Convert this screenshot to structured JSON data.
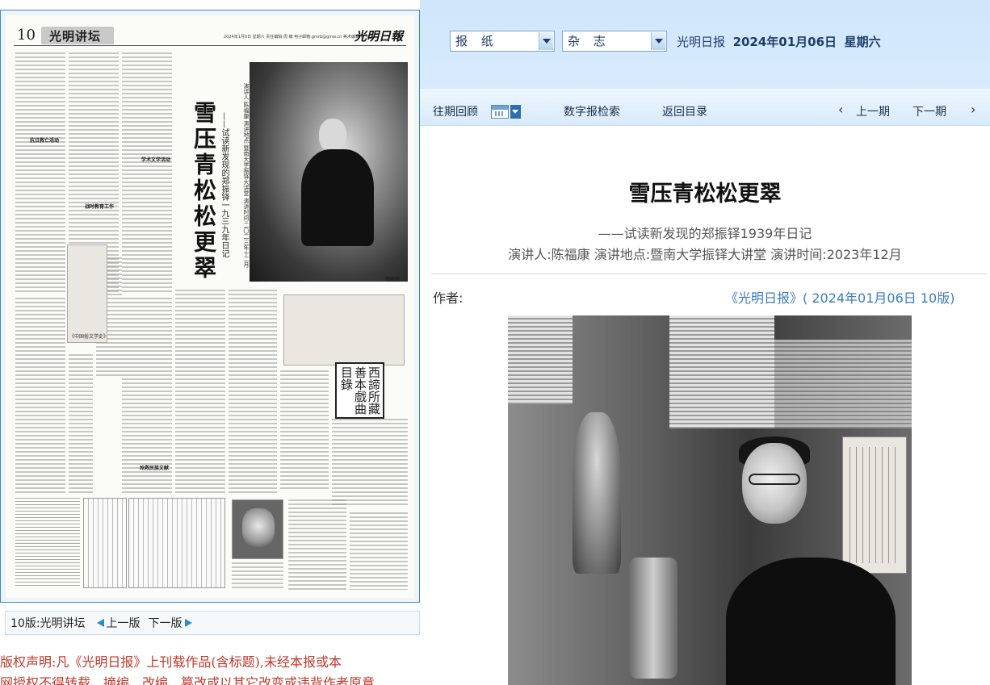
{
  "newspaper_page": {
    "page_number": "10",
    "section_name": "光明讲坛",
    "masthead_meta": "2024年1月6日  星期六  责任编辑:周 编  电子邮箱:gmrb@gmw.cn  美术编辑:何 红",
    "logo_text": "光明日報",
    "vertical_title": "雪压青松松更翠",
    "vertical_subtitle": "——试读新发现的郑振铎一九三九年日记",
    "vertical_meta": "演讲人:陈福康  演讲地点:暨南大学振铎大讲堂  演讲时间:二〇二三年十二月",
    "seal_text": "西諦所藏善本戲曲目錄",
    "subheads": [
      "抗日救亡活动",
      "战时教育工作",
      "学术文学活动",
      "抢救民族文献"
    ],
    "book_label": "《中国俗文学史》",
    "photo_caption": "郑振铎"
  },
  "page_nav": {
    "current_page": "10版:光明讲坛",
    "prev_label": "上一版",
    "next_label": "下一版"
  },
  "copyright": {
    "line1": "版权声明:凡《光明日报》上刊载作品(含标题),未经本报或本",
    "line2": "网授权不得转载、摘编、改编、篡改或以其它改变或违背作者原意"
  },
  "header": {
    "select_newspaper": "报 纸",
    "select_magazine": "杂 志",
    "paper_name": "光明日报",
    "date": "2024年01月06日",
    "weekday": "星期六"
  },
  "nav": {
    "past_issues": "往期回顾",
    "digital_search": "数字报检索",
    "back_to_toc": "返回目录",
    "prev_issue": "上一期",
    "next_issue": "下一期",
    "prev_chevron": "‹",
    "next_chevron": "›"
  },
  "article": {
    "title": "雪压青松松更翠",
    "subtitle": "——试读新发现的郑振铎1939年日记",
    "meta": "演讲人:陈福康  演讲地点:暨南大学振铎大讲堂  演讲时间:2023年12月",
    "author_label": "作者:",
    "source": "《光明日报》( 2024年01月06日  10版)"
  },
  "colors": {
    "header_bg": "#d8ebfc",
    "link_blue": "#3a7cc0",
    "copyright_red": "#c0392b",
    "nav_arrow": "#2a8ad6"
  }
}
